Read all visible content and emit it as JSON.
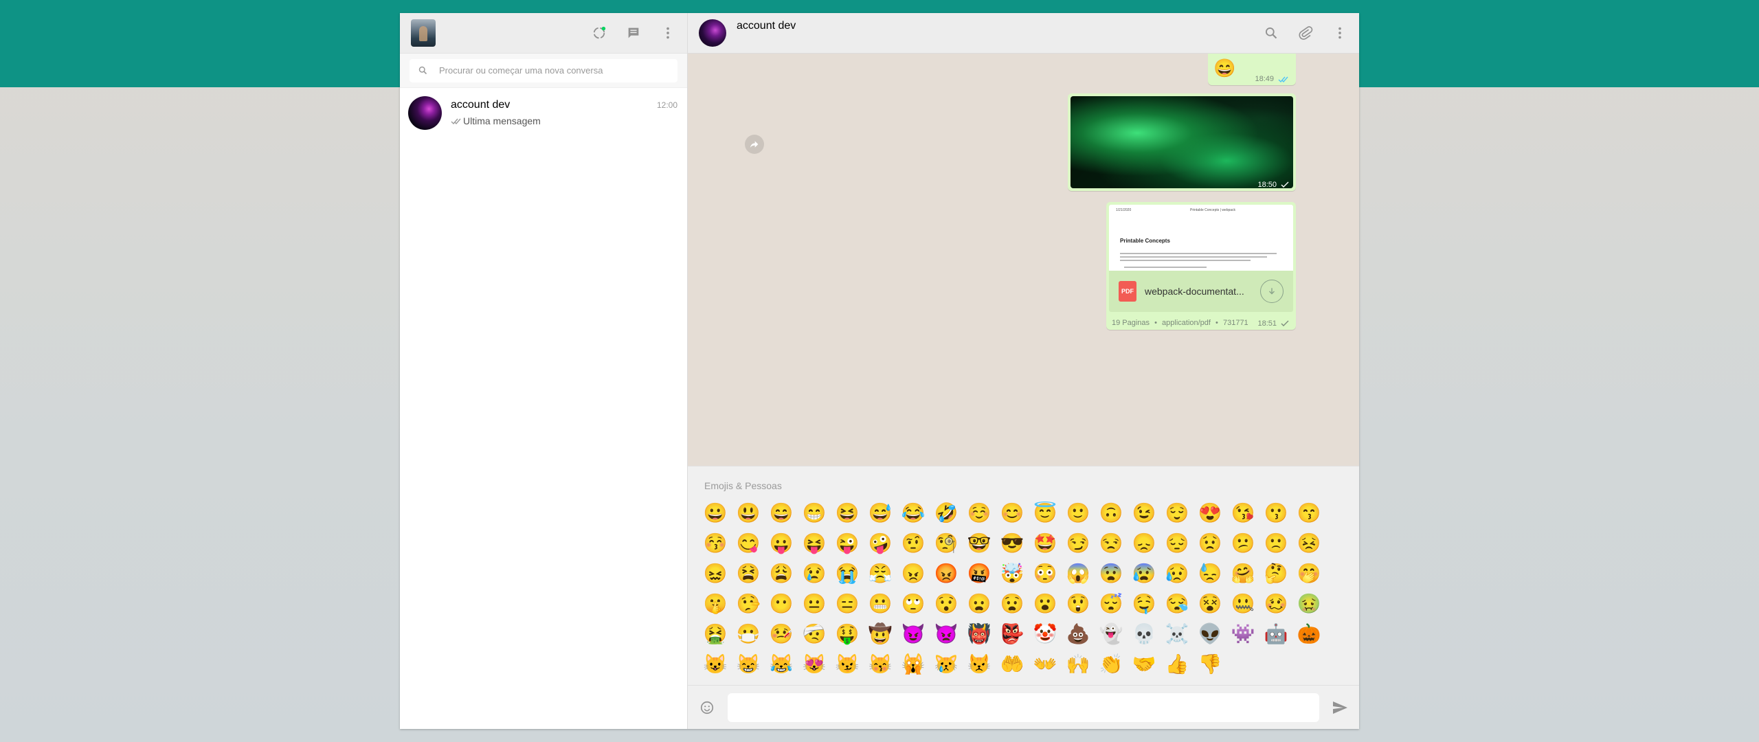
{
  "sidebar": {
    "search_placeholder": "Procurar ou começar uma nova conversa",
    "chats": [
      {
        "name": "account dev",
        "time": "12:00",
        "last_message": "Ultima mensagem"
      }
    ]
  },
  "conversation": {
    "contact_name": "account dev",
    "messages": {
      "emoji": {
        "text": "😄",
        "time": "18:49"
      },
      "image": {
        "time": "18:50"
      },
      "document": {
        "preview_header_left": "1/21/2020",
        "preview_header_right": "Printable Concepts | webpack",
        "preview_title": "Printable Concepts",
        "filename": "webpack-documentat...",
        "pages": "19 Paginas",
        "mime": "application/pdf",
        "size": "731771",
        "time": "18:51",
        "icon_label": "PDF"
      }
    }
  },
  "emoji_panel": {
    "title": "Emojis & Pessoas",
    "emojis": [
      "😀",
      "😃",
      "😄",
      "😁",
      "😆",
      "😅",
      "😂",
      "🤣",
      "☺️",
      "😊",
      "😇",
      "🙂",
      "🙃",
      "😉",
      "😌",
      "😍",
      "😘",
      "😗",
      "😙",
      "😚",
      "😋",
      "😛",
      "😝",
      "😜",
      "🤪",
      "🤨",
      "🧐",
      "🤓",
      "😎",
      "🤩",
      "😏",
      "😒",
      "😞",
      "😔",
      "😟",
      "😕",
      "🙁",
      "😣",
      "😖",
      "😫",
      "😩",
      "😢",
      "😭",
      "😤",
      "😠",
      "😡",
      "🤬",
      "🤯",
      "😳",
      "😱",
      "😨",
      "😰",
      "😥",
      "😓",
      "🤗",
      "🤔",
      "🤭",
      "🤫",
      "🤥",
      "😶",
      "😐",
      "😑",
      "😬",
      "🙄",
      "😯",
      "😦",
      "😧",
      "😮",
      "😲",
      "😴",
      "🤤",
      "😪",
      "😵",
      "🤐",
      "🥴",
      "🤢",
      "🤮",
      "😷",
      "🤒",
      "🤕",
      "🤑",
      "🤠",
      "😈",
      "👿",
      "👹",
      "👺",
      "🤡",
      "💩",
      "👻",
      "💀",
      "☠️",
      "👽",
      "👾",
      "🤖",
      "🎃",
      "😺",
      "😸",
      "😹",
      "😻",
      "😼",
      "😽",
      "🙀",
      "😿",
      "😾",
      "🤲",
      "👐",
      "🙌",
      "👏",
      "🤝",
      "👍",
      "👎"
    ]
  }
}
